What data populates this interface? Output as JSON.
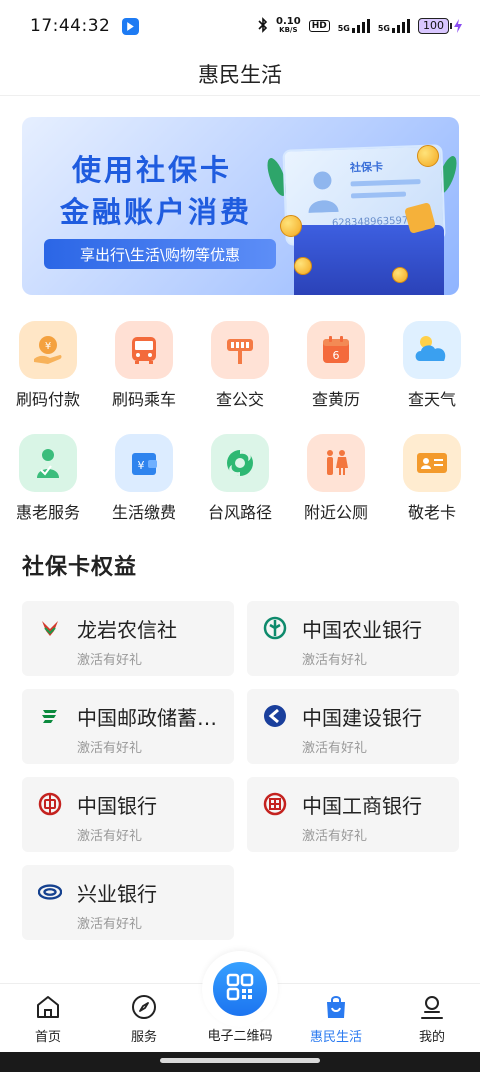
{
  "status_bar": {
    "time": "17:44:32",
    "net_speed_top": "0.10",
    "net_speed_bottom": "KB/S",
    "hd": "HD",
    "sim1": "5G",
    "sim2": "5G",
    "battery": "100"
  },
  "header": {
    "title": "惠民生活"
  },
  "banner": {
    "line1": "使用社保卡",
    "line2": "金融账户消费",
    "tag": "享出行\\生活\\购物等优惠",
    "card_name": "社保卡",
    "card_number": "6283489635978..."
  },
  "services": [
    {
      "label": "刷码付款",
      "icon": "pay-hand-icon",
      "bg": "#ffe4c4",
      "color": "#f39b3c"
    },
    {
      "label": "刷码乘车",
      "icon": "bus-icon",
      "bg": "#ffe0d4",
      "color": "#f36a3b"
    },
    {
      "label": "查公交",
      "icon": "bus-stop-icon",
      "bg": "#ffe2d6",
      "color": "#f47a45"
    },
    {
      "label": "查黄历",
      "icon": "calendar-icon",
      "bg": "#ffe2d4",
      "color": "#f46a3c"
    },
    {
      "label": "查天气",
      "icon": "weather-icon",
      "bg": "#dff0ff",
      "color": "#3aa0f0"
    },
    {
      "label": "惠老服务",
      "icon": "elder-icon",
      "bg": "#d9f5e6",
      "color": "#3bbd7c"
    },
    {
      "label": "生活缴费",
      "icon": "wallet-icon",
      "bg": "#dcecff",
      "color": "#2f84ee"
    },
    {
      "label": "台风路径",
      "icon": "typhoon-icon",
      "bg": "#dcf5e8",
      "color": "#2eb873"
    },
    {
      "label": "附近公厕",
      "icon": "toilet-icon",
      "bg": "#ffe3d6",
      "color": "#f3763e"
    },
    {
      "label": "敬老卡",
      "icon": "elder-card-icon",
      "bg": "#ffecd0",
      "color": "#f39a2c"
    }
  ],
  "section": {
    "title": "社保卡权益"
  },
  "banks": [
    {
      "name": "龙岩农信社",
      "sub": "激活有好礼",
      "icon": "longyan-rcc-logo-icon",
      "color": "#d33a2c"
    },
    {
      "name": "中国农业银行",
      "sub": "激活有好礼",
      "icon": "abc-logo-icon",
      "color": "#0e8a6c"
    },
    {
      "name": "中国邮政储蓄银行",
      "sub": "激活有好礼",
      "icon": "psbc-logo-icon",
      "color": "#0b8a3e"
    },
    {
      "name": "中国建设银行",
      "sub": "激活有好礼",
      "icon": "ccb-logo-icon",
      "color": "#1a3f9c"
    },
    {
      "name": "中国银行",
      "sub": "激活有好礼",
      "icon": "boc-logo-icon",
      "color": "#c4221f"
    },
    {
      "name": "中国工商银行",
      "sub": "激活有好礼",
      "icon": "icbc-logo-icon",
      "color": "#c4221f"
    },
    {
      "name": "兴业银行",
      "sub": "激活有好礼",
      "icon": "cib-logo-icon",
      "color": "#15418f"
    }
  ],
  "tabs": [
    {
      "label": "首页",
      "icon": "home-icon"
    },
    {
      "label": "服务",
      "icon": "compass-icon"
    },
    {
      "label": "电子二维码",
      "icon": "qr-code-icon"
    },
    {
      "label": "惠民生活",
      "icon": "shopping-bag-icon",
      "active": true
    },
    {
      "label": "我的",
      "icon": "user-icon"
    }
  ],
  "colors": {
    "accent": "#2a7af0",
    "banner_text": "#1f5cdf"
  }
}
